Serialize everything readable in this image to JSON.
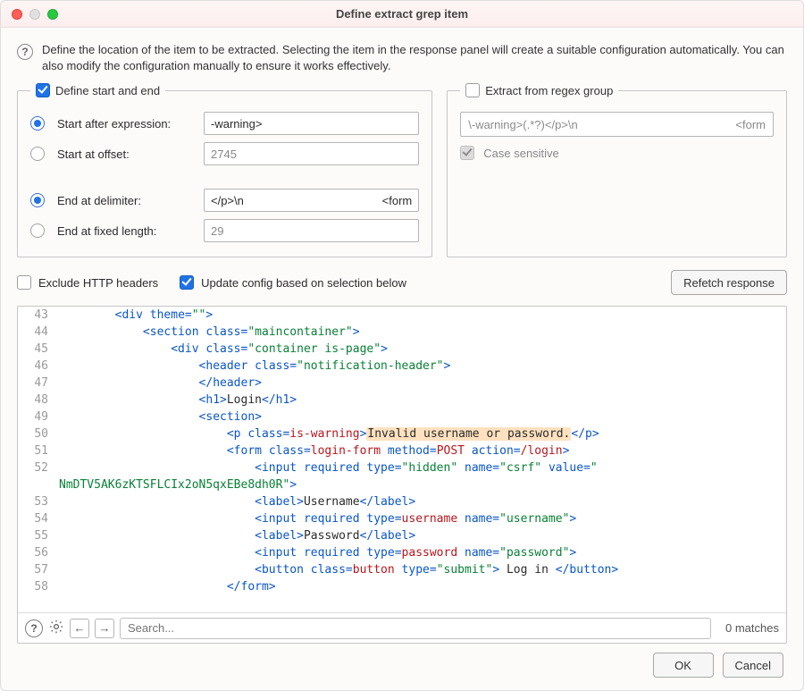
{
  "window": {
    "title": "Define extract grep item"
  },
  "intro": "Define the location of the item to be extracted. Selecting the item in the response panel will create a suitable configuration automatically. You can also modify the configuration manually to ensure it works effectively.",
  "panel_start_end": {
    "legend": "Define start and end",
    "checked": true,
    "start_after_label": "Start after expression:",
    "start_after_value": "-warning>",
    "start_offset_label": "Start at offset:",
    "start_offset_value": "2745",
    "end_delim_label": "End at delimiter:",
    "end_delim_left": "</p>\\n",
    "end_delim_right": "<form",
    "end_fixed_label": "End at fixed length:",
    "end_fixed_value": "29",
    "start_radio_selected": "after",
    "end_radio_selected": "delimiter"
  },
  "panel_regex": {
    "legend": "Extract from regex group",
    "checked": false,
    "regex_left": "\\-warning>(.*?)</p>\\n",
    "regex_right": "<form",
    "case_sensitive_label": "Case sensitive",
    "case_sensitive_checked": true
  },
  "options": {
    "exclude_headers_label": "Exclude HTTP headers",
    "exclude_headers_checked": false,
    "update_config_label": "Update config based on selection below",
    "update_config_checked": true,
    "refetch_label": "Refetch response"
  },
  "editor": {
    "lines": [
      {
        "n": "43",
        "html": "        <span class='c-tag'>&lt;div</span> <span class='c-attr'>theme=</span><span class='c-str'>\"\"</span><span class='c-tag'>&gt;</span>"
      },
      {
        "n": "44",
        "html": "            <span class='c-tag'>&lt;section</span> <span class='c-attr'>class=</span><span class='c-str'>\"maincontainer\"</span><span class='c-tag'>&gt;</span>"
      },
      {
        "n": "45",
        "html": "                <span class='c-tag'>&lt;div</span> <span class='c-attr'>class=</span><span class='c-str'>\"container is-page\"</span><span class='c-tag'>&gt;</span>"
      },
      {
        "n": "46",
        "html": "                    <span class='c-tag'>&lt;header</span> <span class='c-attr'>class=</span><span class='c-str'>\"notification-header\"</span><span class='c-tag'>&gt;</span>"
      },
      {
        "n": "47",
        "html": "                    <span class='c-tag'>&lt;/header&gt;</span>"
      },
      {
        "n": "48",
        "html": "                    <span class='c-tag'>&lt;h1&gt;</span><span class='c-text'>Login</span><span class='c-tag'>&lt;/h1&gt;</span>"
      },
      {
        "n": "49",
        "html": "                    <span class='c-tag'>&lt;section&gt;</span>"
      },
      {
        "n": "50",
        "html": "                        <span class='c-tag'>&lt;p</span> <span class='c-attr'>class=</span><span class='c-aval'>is-warning</span><span class='c-tag'>&gt;</span><span class='hl c-text'>Invalid username or password.</span><span class='c-tag'>&lt;/p&gt;</span>"
      },
      {
        "n": "51",
        "html": "                        <span class='c-tag'>&lt;form</span> <span class='c-attr'>class=</span><span class='c-aval'>login-form</span> <span class='c-attr'>method=</span><span class='c-aval'>POST</span> <span class='c-attr'>action=</span><span class='c-aval'>/login</span><span class='c-tag'>&gt;</span>"
      },
      {
        "n": "52",
        "html": "                            <span class='c-tag'>&lt;input</span> <span class='c-attr'>required</span> <span class='c-attr'>type=</span><span class='c-str'>\"hidden\"</span> <span class='c-attr'>name=</span><span class='c-str'>\"csrf\"</span> <span class='c-attr'>value=</span><span class='c-str'>\"</span>\n<span class='c-str'>NmDTV5AK6zKTSFLCIx2oN5qxEBe8dh0R\"</span><span class='c-tag'>&gt;</span>"
      },
      {
        "n": "53",
        "html": "                            <span class='c-tag'>&lt;label&gt;</span><span class='c-text'>Username</span><span class='c-tag'>&lt;/label&gt;</span>"
      },
      {
        "n": "54",
        "html": "                            <span class='c-tag'>&lt;input</span> <span class='c-attr'>required</span> <span class='c-attr'>type=</span><span class='c-aval'>username</span> <span class='c-attr'>name=</span><span class='c-str'>\"username\"</span><span class='c-tag'>&gt;</span>"
      },
      {
        "n": "55",
        "html": "                            <span class='c-tag'>&lt;label&gt;</span><span class='c-text'>Password</span><span class='c-tag'>&lt;/label&gt;</span>"
      },
      {
        "n": "56",
        "html": "                            <span class='c-tag'>&lt;input</span> <span class='c-attr'>required</span> <span class='c-attr'>type=</span><span class='c-aval'>password</span> <span class='c-attr'>name=</span><span class='c-str'>\"password\"</span><span class='c-tag'>&gt;</span>"
      },
      {
        "n": "57",
        "html": "                            <span class='c-tag'>&lt;button</span> <span class='c-attr'>class=</span><span class='c-aval'>button</span> <span class='c-attr'>type=</span><span class='c-str'>\"submit\"</span><span class='c-tag'>&gt;</span><span class='c-text'> Log in </span><span class='c-tag'>&lt;/button&gt;</span>"
      },
      {
        "n": "58",
        "html": "                        <span class='c-tag'>&lt;/form&gt;</span>"
      }
    ],
    "search_placeholder": "Search...",
    "matches": "0 matches"
  },
  "footer": {
    "ok": "OK",
    "cancel": "Cancel"
  }
}
